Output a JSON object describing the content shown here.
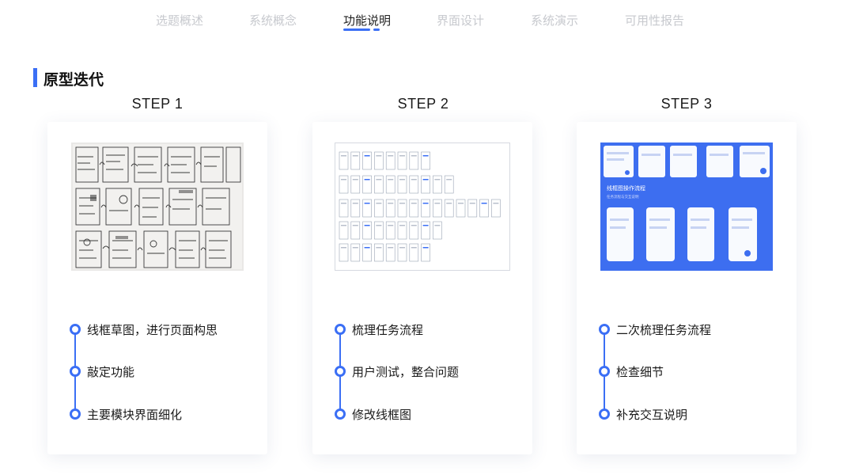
{
  "nav": {
    "items": [
      "选题概述",
      "系统概念",
      "功能说明",
      "界面设计",
      "系统演示",
      "可用性报告"
    ],
    "active_index": 2,
    "accent_color": "#3b6ff5"
  },
  "section": {
    "title": "原型迭代"
  },
  "steps": [
    {
      "title": "STEP 1",
      "image": "hand-drawn wireframe sketch photo",
      "items": [
        "线框草图，进行页面构思",
        "敲定功能",
        "主要模块界面细化"
      ]
    },
    {
      "title": "STEP 2",
      "image": "low-fidelity wireframe grid",
      "items": [
        "梳理任务流程",
        "用户测试，整合问题",
        "修改线框图"
      ]
    },
    {
      "title": "STEP 3",
      "image": "wireframe flow diagram on blue background",
      "image_text": {
        "heading": "线框图操作流程",
        "sub": "任务流程与交互说明"
      },
      "items": [
        "二次梳理任务流程",
        "检查细节",
        "补充交互说明"
      ]
    }
  ]
}
